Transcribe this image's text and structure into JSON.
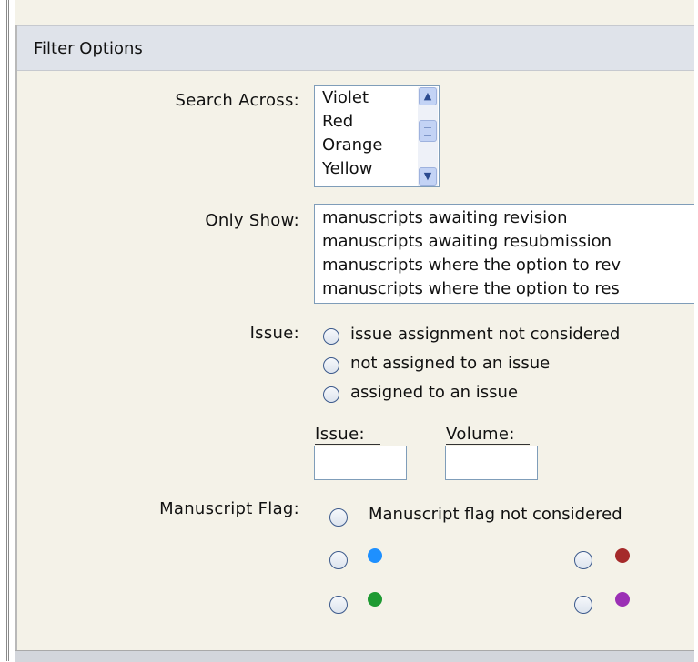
{
  "panel": {
    "title": "Filter Options"
  },
  "search_across": {
    "label": "Search Across:",
    "options": [
      "Violet",
      "Red",
      "Orange",
      "Yellow"
    ]
  },
  "only_show": {
    "label": "Only Show:",
    "options": [
      "manuscripts awaiting revision",
      "manuscripts awaiting resubmission",
      "manuscripts where the option to rev",
      "manuscripts where the option to res"
    ]
  },
  "issue": {
    "label": "Issue:",
    "options": [
      "issue assignment not considered",
      "not assigned to an issue",
      "assigned to an issue"
    ],
    "issue_field_label": "Issue:",
    "volume_field_label": "Volume:",
    "issue_value": "",
    "volume_value": ""
  },
  "manuscript_flag": {
    "label": "Manuscript Flag:",
    "not_considered": "Manuscript flag not considered",
    "flags": [
      {
        "icon": "blue-flag-dot",
        "color": "#1e90ff"
      },
      {
        "icon": "dark-red-flag-dot",
        "color": "#a52a2a"
      },
      {
        "icon": "green-flag-dot",
        "color": "#1e9a32"
      },
      {
        "icon": "purple-flag-dot",
        "color": "#9b30b5"
      }
    ]
  }
}
